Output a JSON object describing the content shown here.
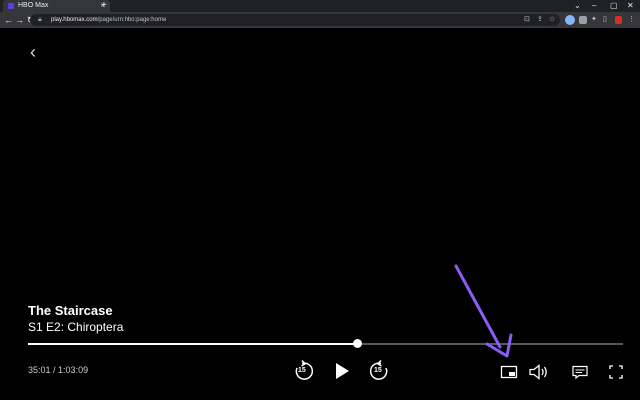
{
  "browser": {
    "tab_title": "HBO Max",
    "tab_close": "×",
    "new_tab": "+",
    "url_host": "play.hbomax.com",
    "url_path": "/page/urn:hbo:page:home"
  },
  "player": {
    "show_title": "The Staircase",
    "episode": "S1 E2: Chiroptera",
    "current_time": "35:01",
    "separator": " / ",
    "duration": "1:03:09",
    "progress": 0.554,
    "skip_back_label": "15",
    "skip_forward_label": "15"
  },
  "annotation": {
    "arrow_color": "#8b5cf6",
    "target": "picture-in-picture-button"
  },
  "icons": [
    "back-icon",
    "skip-back-icon",
    "play-icon",
    "skip-forward-icon",
    "picture-in-picture-icon",
    "volume-icon",
    "subtitles-icon",
    "fullscreen-icon"
  ]
}
